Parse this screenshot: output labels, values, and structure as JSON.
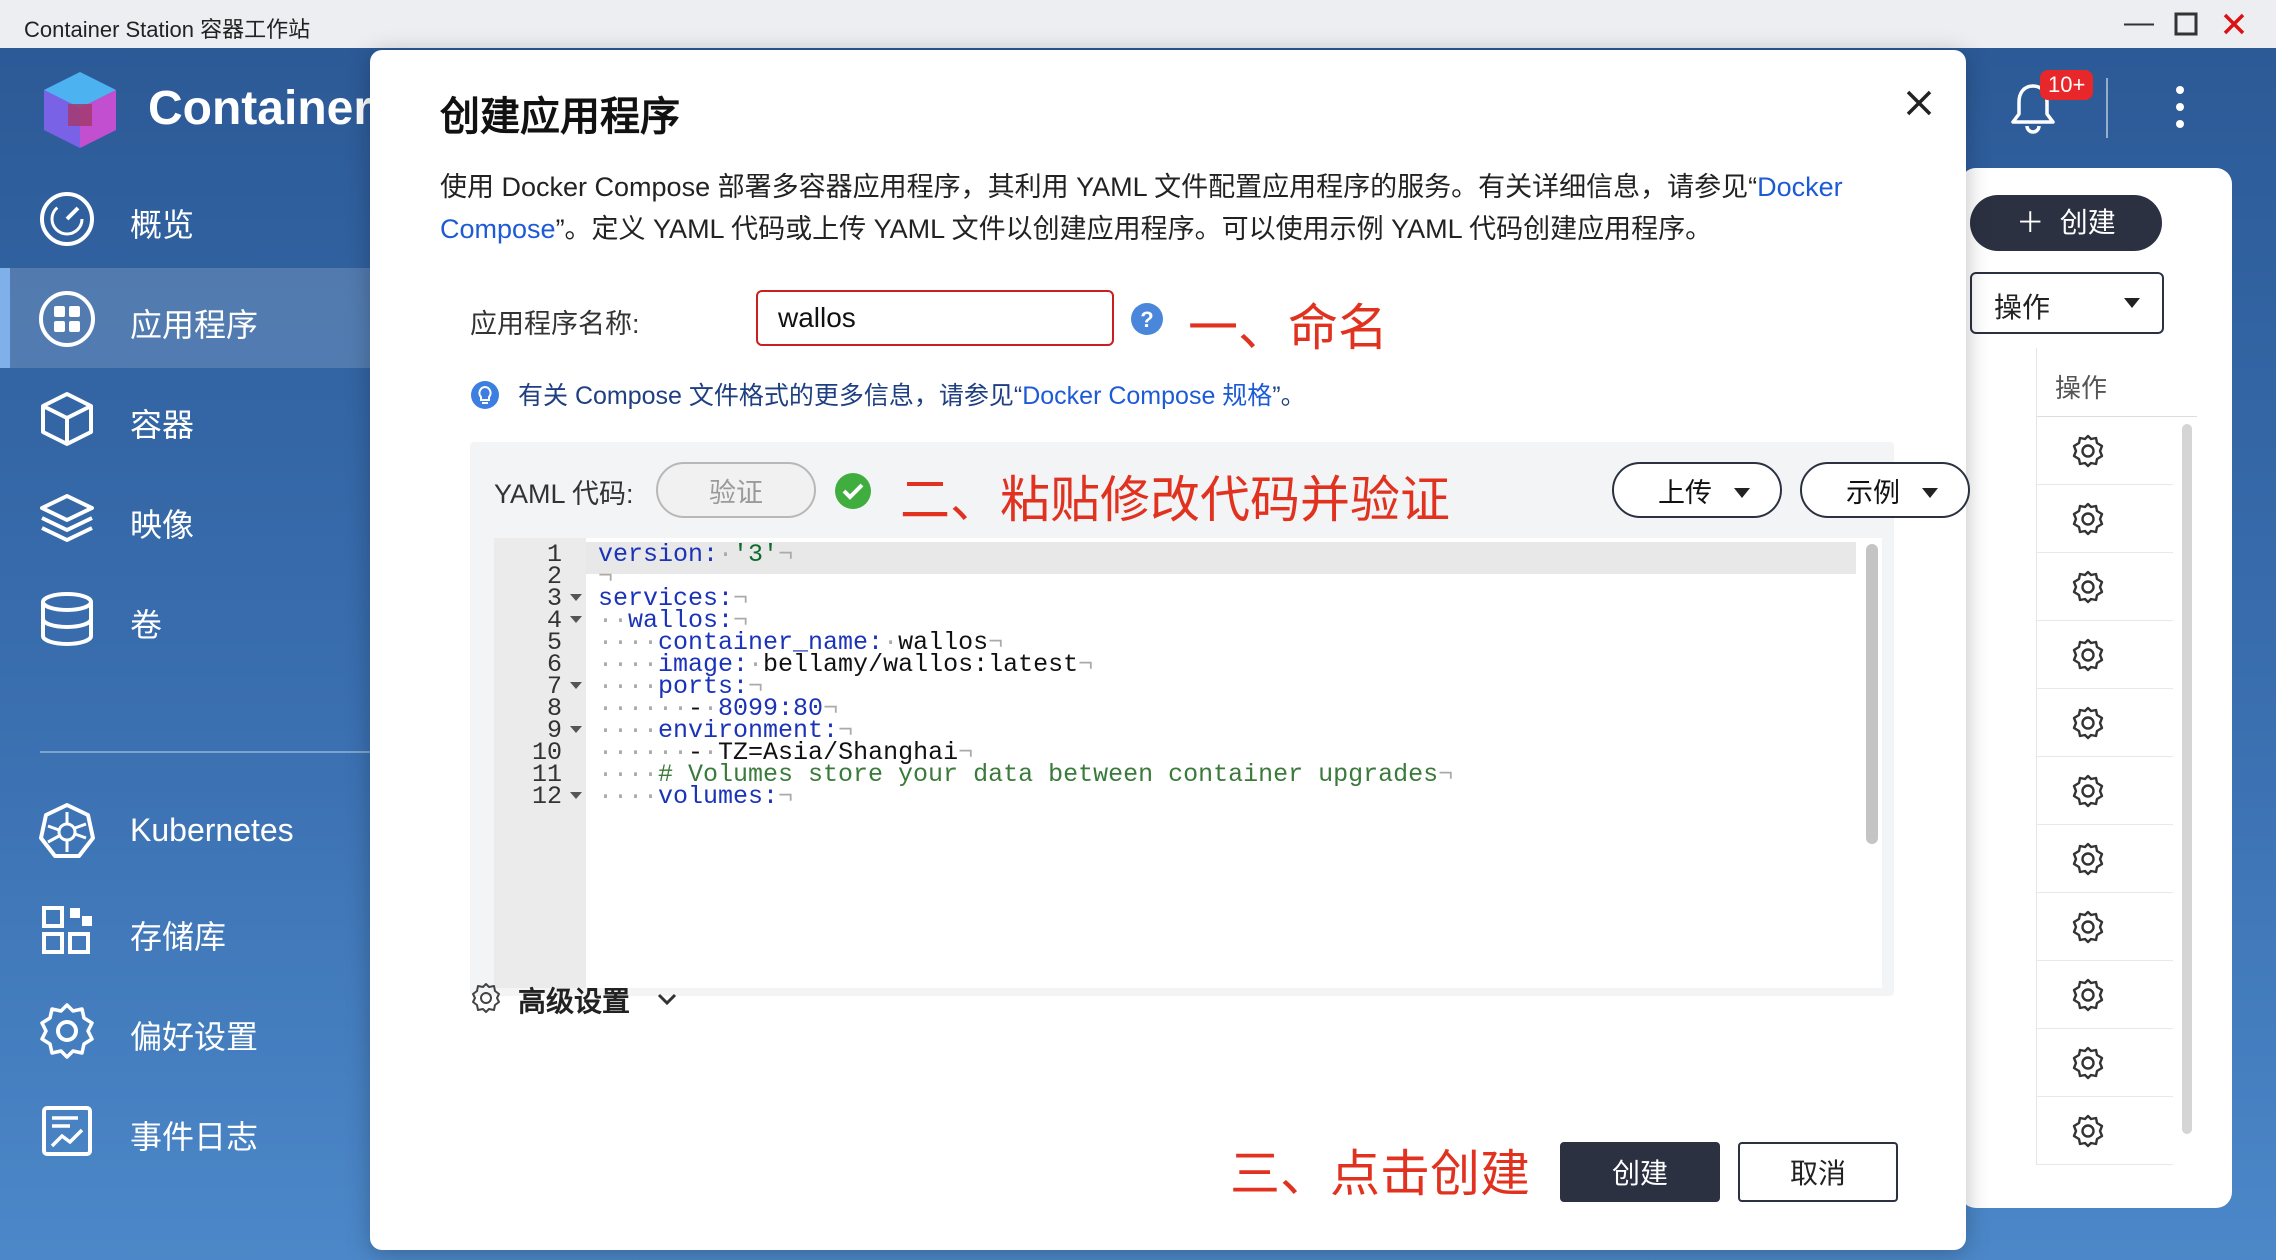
{
  "window": {
    "title": "Container Station 容器工作站",
    "controls": [
      "minimize-icon",
      "maximize-icon",
      "close-icon"
    ]
  },
  "brand": {
    "name": "Container"
  },
  "sidebar": {
    "items": [
      {
        "label": "概览",
        "icon": "dashboard-gauge-icon"
      },
      {
        "label": "应用程序",
        "icon": "apps-grid-icon",
        "active": true
      },
      {
        "label": "容器",
        "icon": "container-cube-icon"
      },
      {
        "label": "映像",
        "icon": "layers-image-icon"
      },
      {
        "label": "卷",
        "icon": "volume-database-icon"
      },
      {
        "label": "Kubernetes",
        "icon": "kubernetes-wheel-icon"
      },
      {
        "label": "存储库",
        "icon": "repository-blocks-icon"
      },
      {
        "label": "偏好设置",
        "icon": "preferences-gear-icon"
      },
      {
        "label": "事件日志",
        "icon": "event-log-chart-icon"
      }
    ]
  },
  "topbar": {
    "notification_badge": "10+",
    "notification_icon": "bell-icon",
    "menu_icon": "kebab-menu-icon"
  },
  "background_panel": {
    "create_button": "创建",
    "operations_select": "操作",
    "column_header": "操作",
    "row_action_icon": "gear-icon",
    "row_count": 11
  },
  "dialog": {
    "title": "创建应用程序",
    "description_part1": "使用 Docker Compose 部署多容器应用程序，其利用 YAML 文件配置应用程序的服务。有关详细信息，请参见“",
    "description_link": "Docker Compose",
    "description_part2": "”。定义 YAML 代码或上传 YAML 文件以创建应用程序。可以使用示例 YAML 代码创建应用程序。",
    "name_label": "应用程序名称:",
    "name_value": "wallos",
    "info_note_part1": "有关 Compose 文件格式的更多信息，请参见“",
    "info_note_link": "Docker Compose 规格",
    "info_note_part2": "”。",
    "yaml_label": "YAML 代码:",
    "verify_button": "验证",
    "upload_button": "上传",
    "example_button": "示例",
    "code_lines": [
      {
        "n": "1"
      },
      {
        "n": "2"
      },
      {
        "n": "3",
        "fold": true
      },
      {
        "n": "4",
        "fold": true
      },
      {
        "n": "5"
      },
      {
        "n": "6"
      },
      {
        "n": "7",
        "fold": true
      },
      {
        "n": "8"
      },
      {
        "n": "9",
        "fold": true
      },
      {
        "n": "10"
      },
      {
        "n": "11"
      },
      {
        "n": "12",
        "fold": true
      }
    ],
    "code_text": {
      "l1_key": "version:",
      "l1_val": "'3'",
      "l3_key": "services:",
      "l4_key": "wallos:",
      "l5_key": "container_name:",
      "l5_val": "wallos",
      "l6_key": "image:",
      "l6_val": "bellamy/wallos:latest",
      "l7_key": "ports:",
      "l8_dash": "-",
      "l8_val": "8099:80",
      "l9_key": "environment:",
      "l10_dash": "-",
      "l10_val": "TZ=Asia/Shanghai",
      "l11_comment": "# Volumes store your data between container upgrades",
      "l12_key": "volumes:"
    },
    "advanced_settings": "高级设置",
    "create_button": "创建",
    "cancel_button": "取消"
  },
  "annotations": {
    "step1": "一、命名",
    "step2": "二、粘贴修改代码并验证",
    "step3": "三、点击创建",
    "color": "#e0321f"
  }
}
